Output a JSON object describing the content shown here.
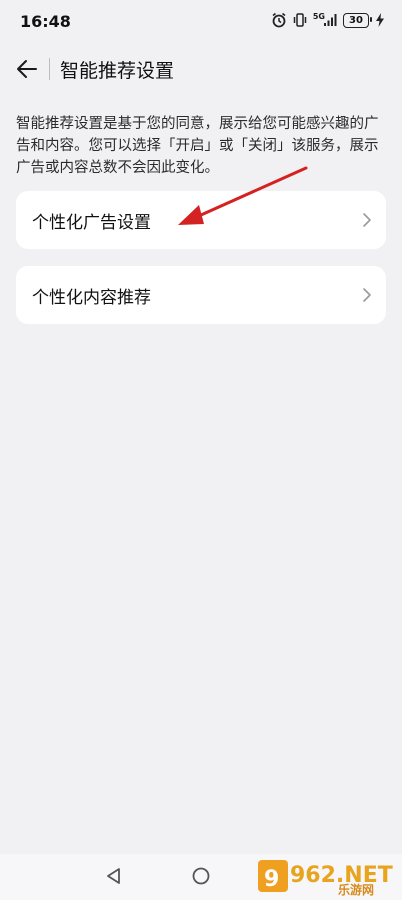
{
  "status_bar": {
    "time": "16:48",
    "network_label": "5G",
    "battery_level": "30",
    "icons": [
      "alarm-icon",
      "vibrate-icon",
      "signal-icon",
      "battery-icon",
      "charging-icon"
    ]
  },
  "header": {
    "title": "智能推荐设置",
    "back_icon": "back-arrow-icon"
  },
  "description": "智能推荐设置是基于您的同意，展示给您可能感兴趣的广告和内容。您可以选择「开启」或「关闭」该服务，展示广告或内容总数不会因此变化。",
  "settings": [
    {
      "label": "个性化广告设置"
    },
    {
      "label": "个性化内容推荐"
    }
  ],
  "nav_bar": {
    "icons": [
      "nav-back-icon",
      "nav-home-icon"
    ]
  },
  "watermark": {
    "text": "962.NET",
    "subtext": "乐游网"
  },
  "colors": {
    "background": "#f1f1f3",
    "card": "#ffffff",
    "annotation_arrow": "#d42121"
  }
}
